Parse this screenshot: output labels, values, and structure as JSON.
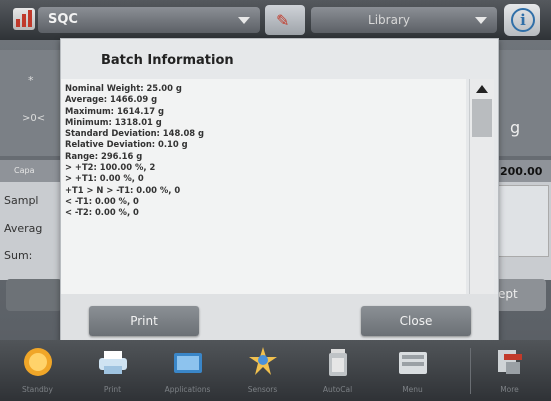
{
  "topbar": {
    "app_name": "SQC",
    "library_label": "Library",
    "info_glyph": "i",
    "tool_icon": "tools-icon"
  },
  "background": {
    "star_glyph": "*",
    "arrow_glyph": ">0<",
    "unit": "g",
    "stat_bar_label": "Capa",
    "value": "200.00",
    "rows": [
      "Sampl",
      "Averag",
      "Sum:"
    ],
    "accept_label": "ept"
  },
  "dialog": {
    "title": "Batch Information",
    "lines": [
      "Nominal Weight: 25.00 g",
      "Average: 1466.09 g",
      "Maximum: 1614.17 g",
      "Minimum: 1318.01 g",
      "Standard Deviation: 148.08 g",
      "Relative Deviation: 0.10 g",
      "Range: 296.16 g",
      "> +T2: 100.00 %, 2",
      "> +T1: 0.00 %, 0",
      "+T1 > N > -T1: 0.00 %, 0",
      "< -T1: 0.00 %, 0",
      "< -T2: 0.00 %, 0"
    ],
    "print_label": "Print",
    "close_label": "Close"
  },
  "toolbar": {
    "items": [
      {
        "label": "Standby",
        "icon": "standby-icon"
      },
      {
        "label": "Print",
        "icon": "printer-icon"
      },
      {
        "label": "Applications",
        "icon": "applications-icon"
      },
      {
        "label": "Sensors",
        "icon": "sensors-icon"
      },
      {
        "label": "AutoCal",
        "icon": "autocal-icon"
      },
      {
        "label": "Menu",
        "icon": "menu-icon"
      },
      {
        "label": "More",
        "icon": "more-icon"
      }
    ]
  },
  "colors": {
    "accent_blue": "#2f6fa8",
    "standby_orange": "#f0a628",
    "brand_red": "#c23a2a"
  }
}
